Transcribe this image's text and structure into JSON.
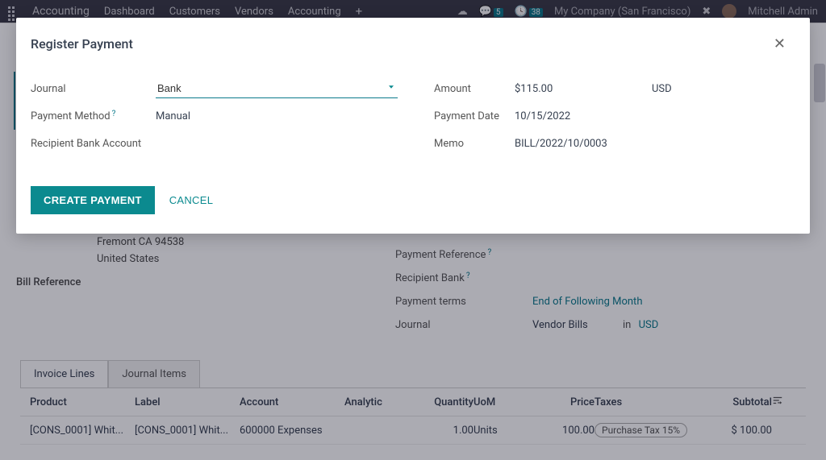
{
  "topnav": {
    "brand": "Accounting",
    "items": [
      "Dashboard",
      "Customers",
      "Vendors",
      "Accounting"
    ],
    "chat_badge": "5",
    "activity_badge": "38",
    "company": "My Company (San Francisco)",
    "user": "Mitchell Admin"
  },
  "modal": {
    "title": "Register Payment",
    "journal_label": "Journal",
    "journal_value": "Bank",
    "payment_method_label": "Payment Method",
    "payment_method_value": "Manual",
    "recipient_bank_label": "Recipient Bank Account",
    "recipient_bank_value": "",
    "amount_label": "Amount",
    "amount_value": "$115.00",
    "currency": "USD",
    "payment_date_label": "Payment Date",
    "payment_date_value": "10/15/2022",
    "memo_label": "Memo",
    "memo_value": "BILL/2022/10/0003",
    "create_label": "CREATE PAYMENT",
    "cancel_label": "CANCEL"
  },
  "bg": {
    "addr_line1": "Fremont CA 94538",
    "addr_line2": "United States",
    "bill_reference_label": "Bill Reference",
    "payment_reference_label": "Payment Reference",
    "recipient_bank_label": "Recipient Bank",
    "payment_terms_label": "Payment terms",
    "payment_terms_value": "End of Following Month",
    "journal_label": "Journal",
    "journal_value": "Vendor Bills",
    "in_word": "in",
    "currency": "USD",
    "tabs": {
      "active": "Invoice Lines",
      "other": "Journal Items"
    },
    "table": {
      "headers": {
        "product": "Product",
        "label": "Label",
        "account": "Account",
        "analytic": "Analytic",
        "quantity": "Quantity",
        "uom": "UoM",
        "price": "Price",
        "taxes": "Taxes",
        "subtotal": "Subtotal"
      },
      "row": {
        "product": "[CONS_0001] Whit...",
        "label": "[CONS_0001] Whit...",
        "account": "600000 Expenses",
        "analytic": "",
        "quantity": "1.00",
        "uom": "Units",
        "price": "100.00",
        "tax": "Purchase Tax 15%",
        "subtotal": "$ 100.00"
      }
    }
  }
}
